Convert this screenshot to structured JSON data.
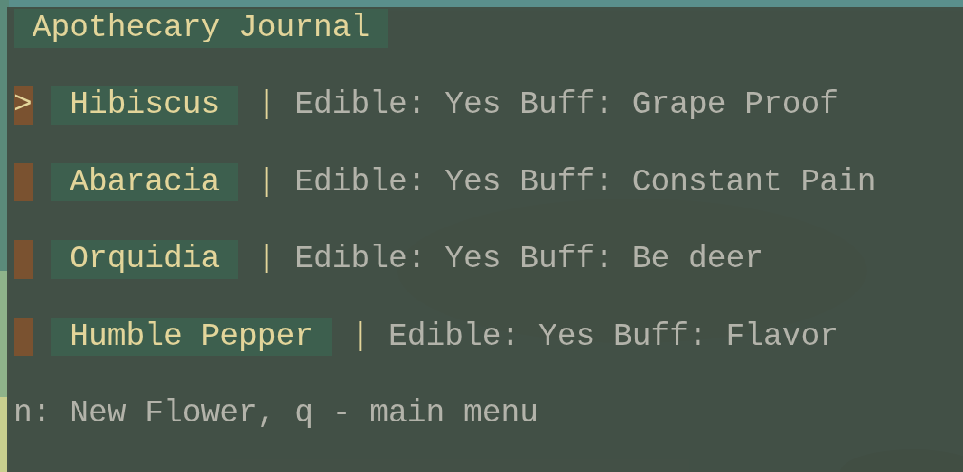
{
  "title": "Apothecary Journal",
  "cursor": ">",
  "separator": "|",
  "flowers": [
    {
      "name": "Hibiscus",
      "details": "Edible: Yes Buff: Grape Proof",
      "selected": true
    },
    {
      "name": "Abaracia",
      "details": "Edible: Yes Buff: Constant Pain",
      "selected": false
    },
    {
      "name": "Orquidia",
      "details": "Edible: Yes Buff: Be deer",
      "selected": false
    },
    {
      "name": "Humble Pepper",
      "details": "Edible: Yes Buff: Flavor",
      "selected": false
    }
  ],
  "footer": "n: New Flower, q - main menu"
}
